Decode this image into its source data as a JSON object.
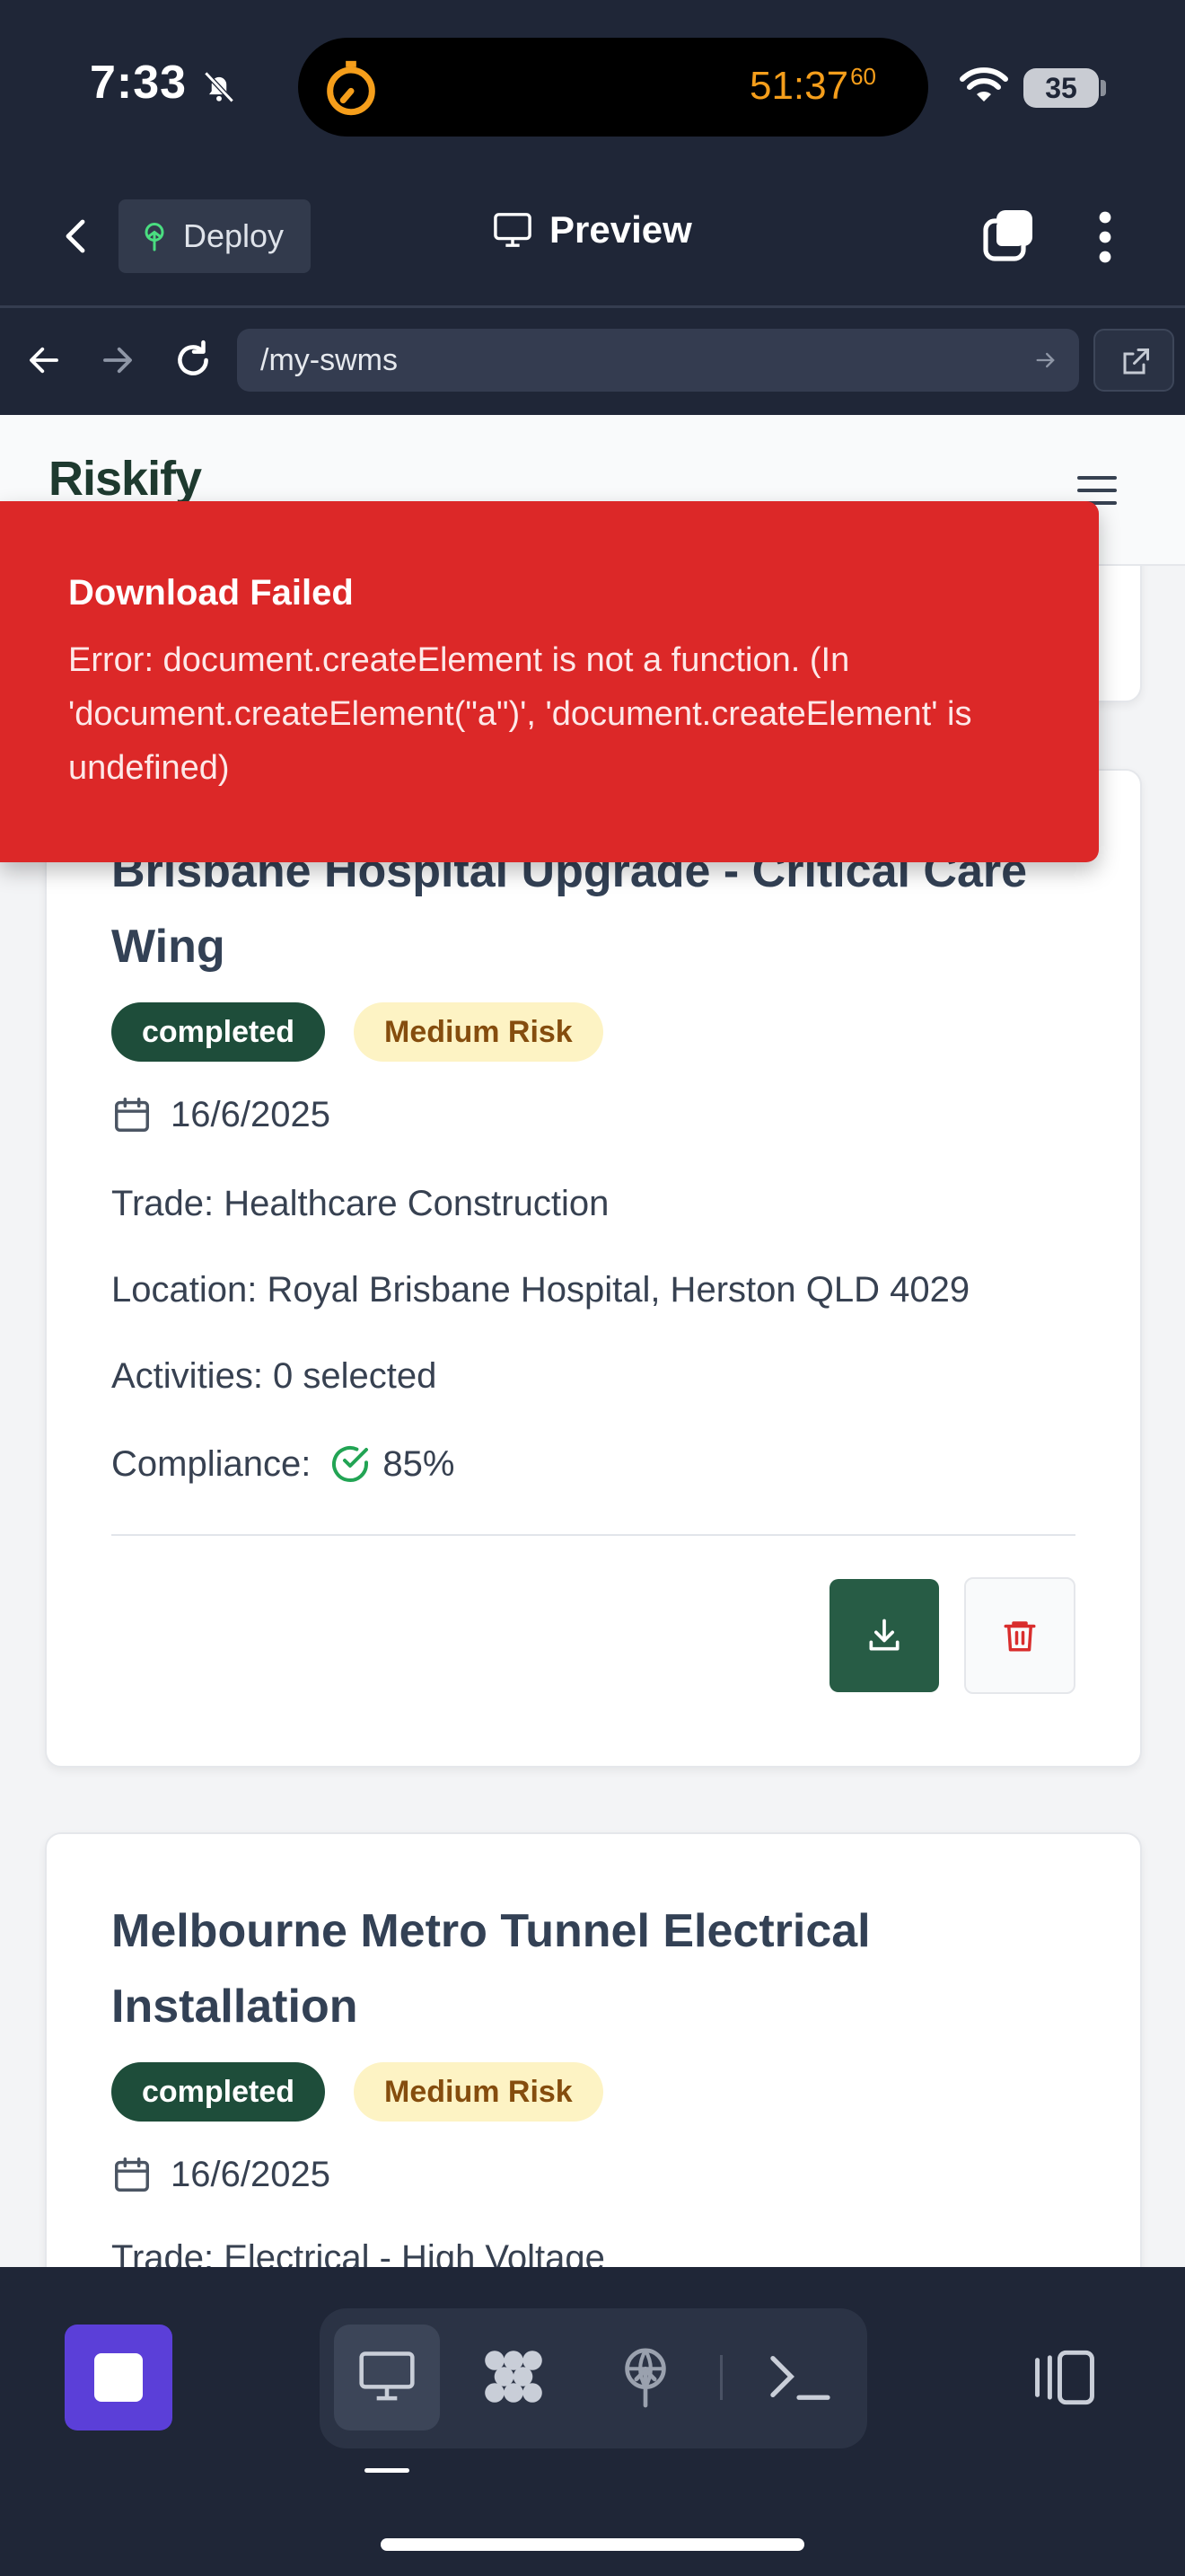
{
  "status_bar": {
    "time": "7:33",
    "timer": "51:37",
    "timer_fraction": "60",
    "battery": "35"
  },
  "ide_header": {
    "deploy_label": "Deploy",
    "preview_label": "Preview"
  },
  "browser": {
    "url": "/my-swms"
  },
  "site": {
    "logo": "Riskify"
  },
  "toast": {
    "title": "Download Failed",
    "message": "Error: document.createElement is not a function. (In 'document.createElement(\"a\")', 'document.createElement' is undefined)"
  },
  "cards": [
    {
      "title": "Brisbane Hospital Upgrade - Critical Care Wing",
      "status": "completed",
      "risk": "Medium Risk",
      "date": "16/6/2025",
      "trade": "Trade: Healthcare Construction",
      "location": "Location: Royal Brisbane Hospital, Herston QLD 4029",
      "activities": "Activities: 0 selected",
      "compliance_label": "Compliance:",
      "compliance_value": "85%"
    },
    {
      "title": "Melbourne Metro Tunnel Electrical Installation",
      "status": "completed",
      "risk": "Medium Risk",
      "date": "16/6/2025",
      "trade": "Trade: Electrical - High Voltage"
    }
  ],
  "colors": {
    "accent_green": "#275c45",
    "toast_red": "#dc2828",
    "stop_purple": "#5b3fd8",
    "timer_orange": "#f59e1b"
  }
}
